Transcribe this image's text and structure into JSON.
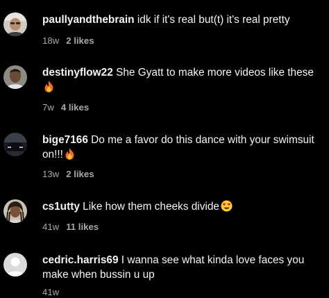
{
  "comments": [
    {
      "username": "paullyandthebrain",
      "text_line1": "idk if it's real but(t) it's real pretty",
      "text_line2": "",
      "time": "18w",
      "likes": "2 likes",
      "emoji": "",
      "avatar": "man-glasses-photo"
    },
    {
      "username": "destinyflow22",
      "text_line1": "She Gyatt to make more videos like these",
      "text_line2": "",
      "time": "7w",
      "likes": "4 likes",
      "emoji": "fire-emoji",
      "avatar": "man-portrait-photo"
    },
    {
      "username": "bige7166",
      "text_line1": "Do me a favor do this dance with your swimsuit",
      "text_line2": "on!!!",
      "time": "13w",
      "likes": "2 likes",
      "emoji": "fire-emoji",
      "avatar": "car-photo"
    },
    {
      "username": "cs1utty",
      "text_line1": "Like how them cheeks divide",
      "text_line2": "",
      "time": "41w",
      "likes": "11 likes",
      "emoji": "heart-eyes-emoji",
      "avatar": "man-dreadlocks-photo"
    },
    {
      "username": "cedric.harris69",
      "text_line1": "I wanna see what kinda love faces you",
      "text_line2": "make when bussin u up",
      "time": "41w",
      "likes": "",
      "emoji": "",
      "avatar": "default-avatar"
    }
  ],
  "colors": {
    "background": "#000000",
    "primary_text": "#f5f5f5",
    "secondary_text": "#a8a8a8"
  }
}
